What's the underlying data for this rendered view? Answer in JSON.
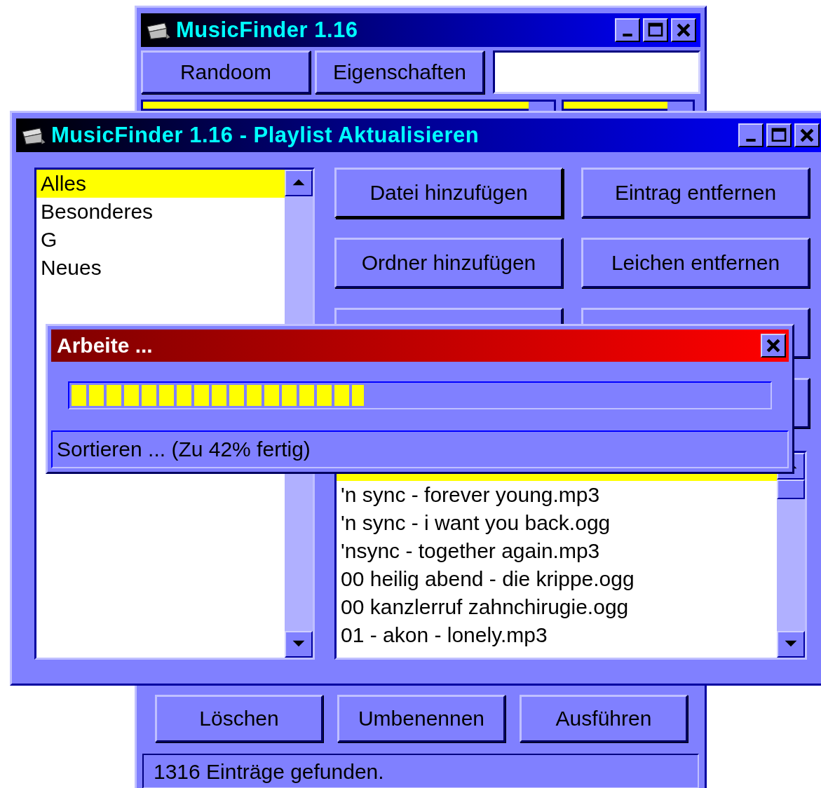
{
  "back_window": {
    "title": "MusicFinder 1.16",
    "toolbar_buttons": [
      "Randoom",
      "Eigenschaften"
    ],
    "bottom_buttons": [
      "Löschen",
      "Umbenennen",
      "Ausführen"
    ],
    "status_bar": "1316 Einträge gefunden."
  },
  "playlist_window": {
    "title": "MusicFinder 1.16 - Playlist Aktualisieren",
    "playlists": [
      {
        "label": "Alles",
        "selected": true
      },
      {
        "label": "Besonderes",
        "selected": false
      },
      {
        "label": "G",
        "selected": false
      },
      {
        "label": "Neues",
        "selected": false
      }
    ],
    "buttons": [
      "Datei hinzufügen",
      "Eintrag entfernen",
      "Ordner hinzufügen",
      "Leichen entfernen"
    ],
    "files": [
      {
        "selected": true
      },
      {
        "label": "'n sync - forever young.mp3",
        "selected": false
      },
      {
        "label": "'n sync - i want you back.ogg",
        "selected": false
      },
      {
        "label": "'nsync - together again.mp3",
        "selected": false
      },
      {
        "label": "00 heilig abend - die krippe.ogg",
        "selected": false
      },
      {
        "label": "00 kanzlerruf zahnchirugie.ogg",
        "selected": false
      },
      {
        "label": "01 - akon - lonely.mp3",
        "selected": false
      }
    ]
  },
  "progress_dialog": {
    "title": "Arbeite ...",
    "level": 0.42,
    "status": "Sortieren ... (Zu 42% fertig)"
  }
}
